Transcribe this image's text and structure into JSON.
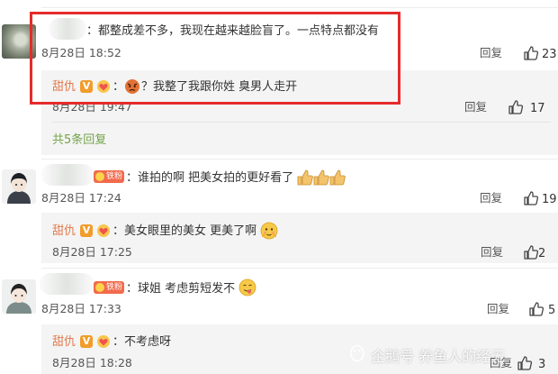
{
  "comments": [
    {
      "text": "都整成差不多，我现在越来越脸盲了。一点特点都没有",
      "date": "8月28日 18:52",
      "reply_label": "回复",
      "like_count": "23"
    },
    {
      "user": "甜仇",
      "text": "？我整了我跟你姓 臭男人走开",
      "date": "8月28日 19:47",
      "reply_label": "回复",
      "like_count": "17"
    },
    {
      "more_replies": "共5条回复"
    },
    {
      "badge": "铁粉",
      "text": "谁拍的啊 把美女拍的更好看了",
      "date": "8月28日 17:24",
      "reply_label": "回复",
      "like_count": "19"
    },
    {
      "user": "甜仇",
      "text": "美女眼里的美女 更美了啊",
      "date": "8月28日 17:25",
      "reply_label": "回复",
      "like_count": "2"
    },
    {
      "badge": "铁粉",
      "text": "球姐 考虑剪短发不",
      "date": "8月28日 17:33",
      "reply_label": "回复",
      "like_count": "5"
    },
    {
      "user": "甜仇",
      "text": "不考虑呀",
      "date": "8月28日 18:28",
      "reply_label": "回复",
      "like_count": "3"
    }
  ],
  "badges": {
    "v": "V"
  },
  "watermark": "企鹅号 养鱼人的经无",
  "colors": {
    "highlight_border": "#e62b2b",
    "username": "#e2794c",
    "link_green": "#74a34a"
  }
}
